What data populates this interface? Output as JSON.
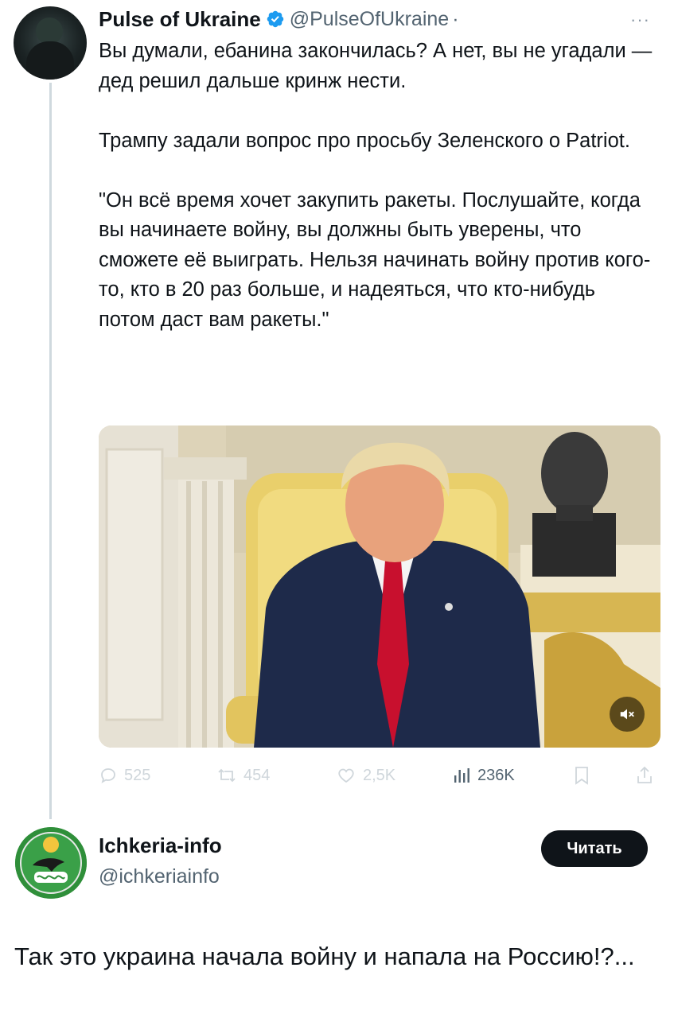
{
  "quoted_tweet": {
    "author": {
      "display_name": "Pulse of Ukraine",
      "handle": "@PulseOfUkraine",
      "separator": "·",
      "avatar_icon": "avatar-soldier-photo",
      "verified_icon": "verified-badge-icon"
    },
    "more_label": "···",
    "text": {
      "line1": "Вы думали, ебанина закончилась? А нет, вы не угадали — дед решил дальше кринж нести.",
      "line2": "Трампу задали вопрос про просьбу Зеленского о Patriot.",
      "line3": "\"Он всё время хочет закупить ракеты. Послушайте, когда вы начинаете войну, вы должны быть уверены, что сможете её выиграть. Нельзя начинать войну против кого-то, кто в 20 раз больше, и надеяться, что кто-нибудь потом даст вам ракеты.\""
    },
    "media": {
      "icon": "video-thumbnail",
      "mute_icon": "muted-speaker-icon"
    },
    "actions": {
      "replies": "525",
      "reposts": "454",
      "likes": "2,5K",
      "views": "236K"
    }
  },
  "reply": {
    "author": {
      "display_name": "Ichkeria-info",
      "handle": "@ichkeriainfo",
      "avatar_icon": "ichkeria-emblem-avatar"
    },
    "follow_label": "Читать",
    "text": "Так это украина начала войну и напала на Россию!?..."
  },
  "colors": {
    "text_primary": "#0f1419",
    "text_secondary": "#536471",
    "verified_blue": "#1d9bf0",
    "action_faded": "#cfd6db",
    "button_bg": "#0f1419"
  }
}
